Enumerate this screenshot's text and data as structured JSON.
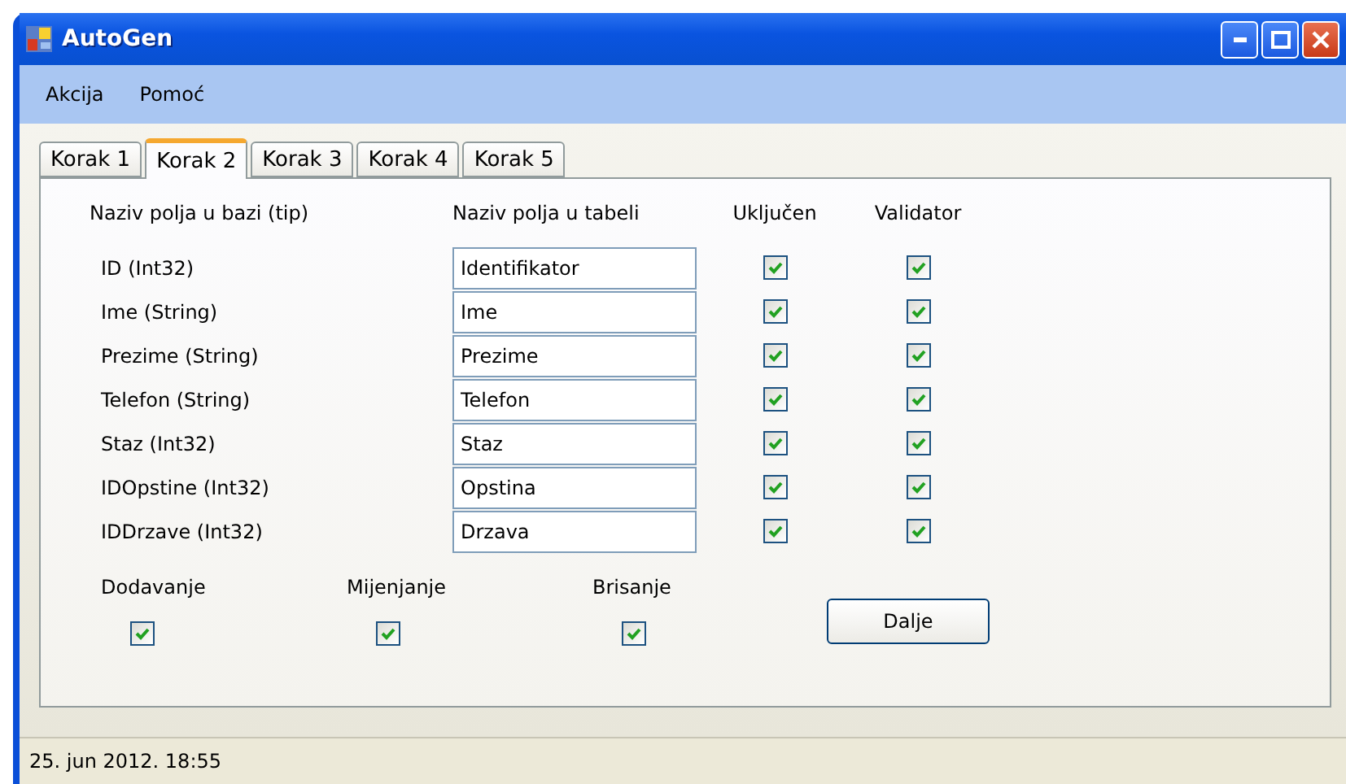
{
  "window": {
    "title": "AutoGen"
  },
  "menu": [
    "Akcija",
    "Pomoć"
  ],
  "tabs": [
    {
      "label": "Korak 1",
      "selected": false
    },
    {
      "label": "Korak 2",
      "selected": true
    },
    {
      "label": "Korak 3",
      "selected": false
    },
    {
      "label": "Korak 4",
      "selected": false
    },
    {
      "label": "Korak 5",
      "selected": false
    }
  ],
  "columns": [
    "Naziv polja u bazi (tip)",
    "Naziv polja u tabeli",
    "Uključen",
    "Validator"
  ],
  "fields": [
    {
      "db_name": "ID (Int32)",
      "table_name": "Identifikator",
      "included": true,
      "validator": true
    },
    {
      "db_name": "Ime (String)",
      "table_name": "Ime",
      "included": true,
      "validator": true
    },
    {
      "db_name": "Prezime (String)",
      "table_name": "Prezime",
      "included": true,
      "validator": true
    },
    {
      "db_name": "Telefon (String)",
      "table_name": "Telefon",
      "included": true,
      "validator": true
    },
    {
      "db_name": "Staz (Int32)",
      "table_name": "Staz",
      "included": true,
      "validator": true
    },
    {
      "db_name": "IDOpstine (Int32)",
      "table_name": "Opstina",
      "included": true,
      "validator": true
    },
    {
      "db_name": "IDDrzave (Int32)",
      "table_name": "Drzava",
      "included": true,
      "validator": true
    }
  ],
  "operations": [
    {
      "label": "Dodavanje",
      "checked": true
    },
    {
      "label": "Mijenjanje",
      "checked": true
    },
    {
      "label": "Brisanje",
      "checked": true
    }
  ],
  "next_button": "Dalje",
  "status_bar": "25. jun 2012. 18:55"
}
